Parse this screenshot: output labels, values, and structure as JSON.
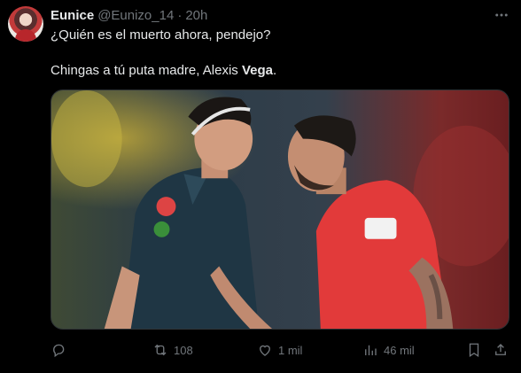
{
  "tweet": {
    "author_name": "Eunice",
    "author_handle": "@Eunizo_14",
    "separator": "·",
    "time": "20h",
    "line1": "¿Quién es el muerto ahora, pendejo?",
    "line2_prefix": "Chingas a tú puta madre, Alexis ",
    "line2_bold": "Vega",
    "line2_suffix": "."
  },
  "actions": {
    "replies": "",
    "retweets": "108",
    "likes": "1 mil",
    "views": "46 mil"
  },
  "colors": {
    "background": "#000000",
    "text_primary": "#e7e9ea",
    "text_secondary": "#71767b",
    "border": "#2f3336"
  },
  "icons": [
    "avatar",
    "more-icon",
    "reply-icon",
    "retweet-icon",
    "like-icon",
    "views-icon",
    "bookmark-icon",
    "share-icon"
  ]
}
